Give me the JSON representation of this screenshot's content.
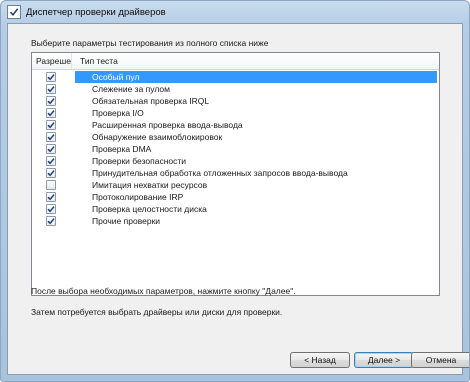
{
  "window": {
    "title": "Диспетчер проверки драйверов"
  },
  "instruction": "Выберите параметры тестирования из полного списка ниже",
  "list": {
    "columns": [
      "Разреше...",
      "Тип теста"
    ],
    "rows": [
      {
        "label": "Особый пул",
        "checked": true,
        "selected": true
      },
      {
        "label": "Слежение за пулом",
        "checked": true
      },
      {
        "label": "Обязательная проверка IRQL",
        "checked": true
      },
      {
        "label": "Проверка I/O",
        "checked": true
      },
      {
        "label": "Расширенная проверка ввода-вывода",
        "checked": true
      },
      {
        "label": "Обнаружение взаимоблокировок",
        "checked": true
      },
      {
        "label": "Проверка DMA",
        "checked": true
      },
      {
        "label": "Проверки безопасности",
        "checked": true
      },
      {
        "label": "Принудительная обработка отложенных запросов ввода-вывода",
        "checked": true
      },
      {
        "label": "Имитация нехватки ресурсов",
        "checked": false
      },
      {
        "label": "Протоколирование IRP",
        "checked": true
      },
      {
        "label": "Проверка целостности диска",
        "checked": true
      },
      {
        "label": "Прочие проверки",
        "checked": true
      }
    ]
  },
  "notes": {
    "line1": "После выбора необходимых параметров, нажмите кнопку \"Далее\".",
    "line2": "Затем потребуется выбрать драйверы или диски для проверки."
  },
  "buttons": {
    "back": "< Назад",
    "next": "Далее >",
    "cancel": "Отмена"
  },
  "colors": {
    "selection": "#3399ff",
    "checkmark": "#21407a"
  },
  "icons": {
    "window": "checkmark-app-icon",
    "check": "checkmark-icon"
  }
}
